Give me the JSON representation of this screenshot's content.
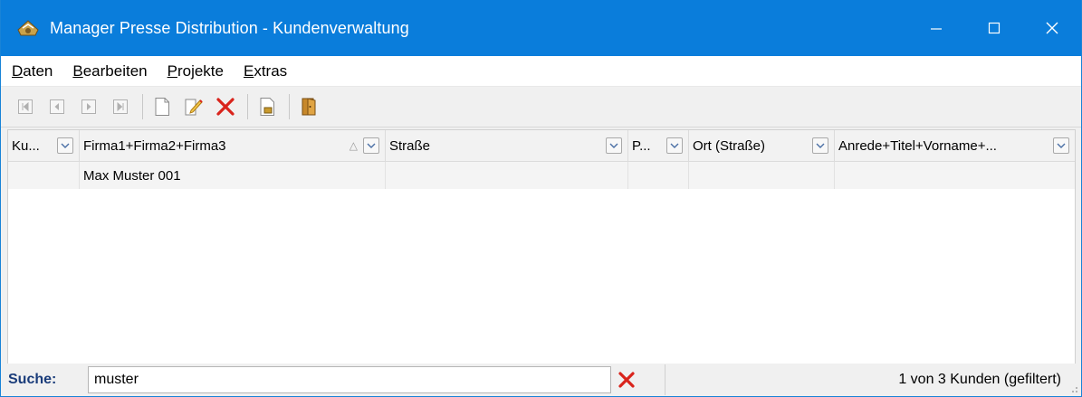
{
  "window": {
    "title": "Manager Presse Distribution - Kundenverwaltung"
  },
  "menu": {
    "items": [
      {
        "label": "Daten",
        "mnemonic": "D",
        "rest": "aten"
      },
      {
        "label": "Bearbeiten",
        "mnemonic": "B",
        "rest": "earbeiten"
      },
      {
        "label": "Projekte",
        "mnemonic": "P",
        "rest": "rojekte"
      },
      {
        "label": "Extras",
        "mnemonic": "E",
        "rest": "xtras"
      }
    ]
  },
  "toolbar": {
    "icons": [
      "first-record-icon",
      "previous-record-icon",
      "next-record-icon",
      "last-record-icon",
      "new-document-icon",
      "edit-icon",
      "delete-icon",
      "print-preview-icon",
      "exit-door-icon"
    ]
  },
  "grid": {
    "columns": [
      "Ku...",
      "Firma1+Firma2+Firma3",
      "Straße",
      "P...",
      "Ort (Straße)",
      "Anrede+Titel+Vorname+..."
    ],
    "sorted_column_indicator": "△",
    "rows": [
      [
        "",
        "Max Muster 001",
        "",
        "",
        "",
        ""
      ]
    ]
  },
  "search": {
    "label": "Suche:",
    "value": "muster"
  },
  "status": {
    "text": "1 von 3 Kunden (gefiltert)"
  },
  "colors": {
    "titlebar": "#0a7ddb",
    "delete_red": "#d9241c",
    "search_label": "#1a3c7a"
  }
}
